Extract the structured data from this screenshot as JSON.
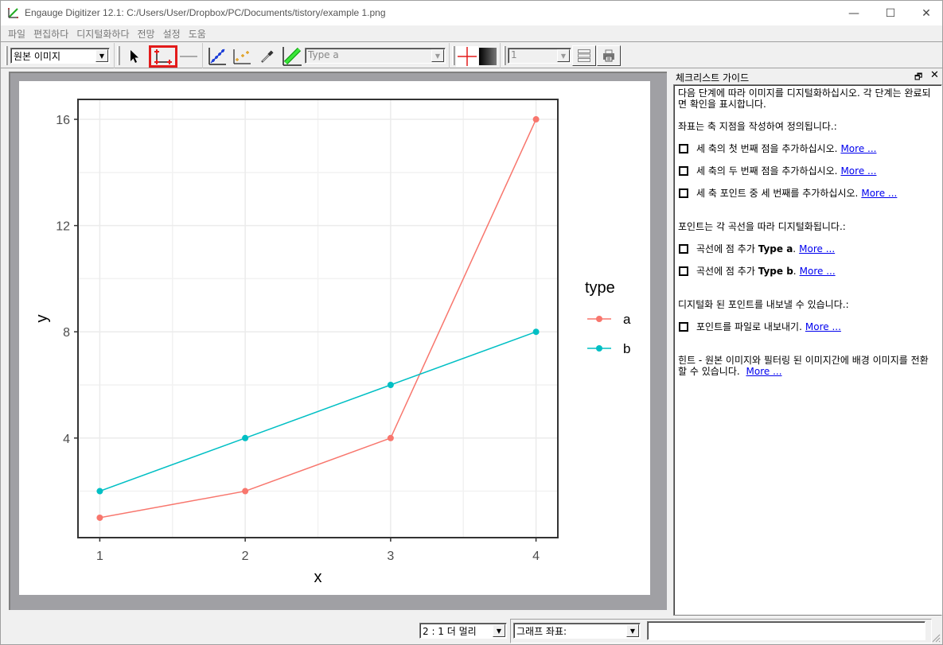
{
  "window": {
    "title": "Engauge Digitizer 12.1: C:/Users/User/Dropbox/PC/Documents/tistory/example 1.png",
    "controls": {
      "minimize": "—",
      "maximize": "☐",
      "close": "✕"
    }
  },
  "menu": [
    "파일",
    "편집하다",
    "디지털화하다",
    "전망",
    "설정",
    "도움"
  ],
  "toolbar": {
    "background_select": "원본 이미지",
    "curve_select": "Type a",
    "coord_system_select": "1",
    "active_tool": "axis-point-tool",
    "tools": [
      "select-tool",
      "axis-point-tool",
      "axis-scale-tool",
      "curve-point-tool",
      "point-match-tool",
      "color-picker-tool",
      "segment-fill-tool"
    ],
    "accent_color": "#e31b1b"
  },
  "checklist": {
    "title": "체크리스트 가이드",
    "intro": "다음 단계에 따라 이미지를 디지털화하십시오. 각 단계는 완료되면 확인을 표시합니다.",
    "axis_heading": "좌표는 축 지점을 작성하여 정의됩니다.:",
    "axis_items": [
      {
        "text": "세 축의 첫 번째 점을 추가하십시오.",
        "link": "More ...",
        "checked": false
      },
      {
        "text": "세 축의 두 번째 점을 추가하십시오.",
        "link": "More ...",
        "checked": false
      },
      {
        "text": "세 축 포인트 중 세 번째를 추가하십시오.",
        "link": "More ...",
        "checked": false
      }
    ],
    "curve_heading": "포인트는 각 곡선을 따라 디지털화됩니다.:",
    "curve_items": [
      {
        "prefix": "곡선에 점 추가",
        "curve": "Type a",
        "link": "More ...",
        "checked": false
      },
      {
        "prefix": "곡선에 점 추가",
        "curve": "Type b",
        "link": "More ...",
        "checked": false
      }
    ],
    "export_heading": "디지털화 된 포인트를 내보낼 수 있습니다.:",
    "export_items": [
      {
        "text": "포인트를 파일로 내보내기.",
        "link": "More ...",
        "checked": false
      }
    ],
    "hint": "힌트 - 원본 이미지와 필터링 된 이미지간에 배경 이미지를 전환 할 수 있습니다.",
    "hint_link": "More ..."
  },
  "status": {
    "zoom_select": "2 : 1 더 멀리",
    "coords_select": "그래프 좌표:",
    "coords_value": ""
  },
  "chart_data": {
    "type": "line",
    "x": [
      1,
      2,
      3,
      4
    ],
    "series": [
      {
        "name": "a",
        "values": [
          1,
          2,
          4,
          16
        ],
        "color": "#f8766d"
      },
      {
        "name": "b",
        "values": [
          2,
          4,
          6,
          8
        ],
        "color": "#00bfc4"
      }
    ],
    "xlabel": "x",
    "ylabel": "y",
    "xticks": [
      1,
      2,
      3,
      4
    ],
    "yticks": [
      4,
      8,
      12,
      16
    ],
    "xlim": [
      0.85,
      4.15
    ],
    "ylim": [
      0.25,
      16.75
    ],
    "legend_title": "type",
    "legend_position": "right",
    "grid": true
  }
}
